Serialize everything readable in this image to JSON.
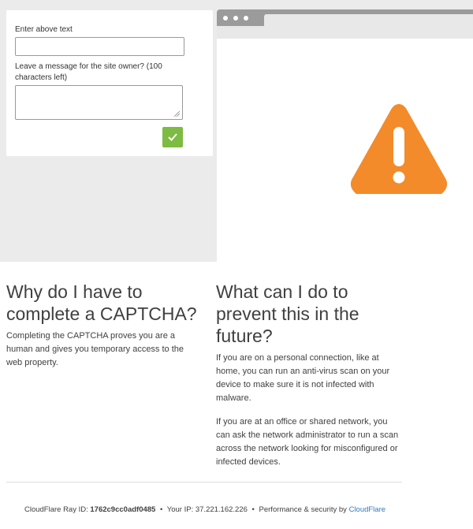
{
  "captcha_form": {
    "input_label": "Enter above text",
    "input_value": "",
    "message_label": "Leave a message for the site owner? (100 characters left)",
    "message_value": ""
  },
  "section_why": {
    "heading": "Why do I have to complete a CAPTCHA?",
    "body": "Completing the CAPTCHA proves you are a human and gives you temporary access to the web property."
  },
  "section_prevent": {
    "heading": "What can I do to prevent this in the future?",
    "paragraph1": "If you are on a personal connection, like at home, you can run an anti-virus scan on your device to make sure it is not infected with malware.",
    "paragraph2": "If you are at an office or shared network, you can ask the network administrator to run a scan across the network looking for misconfigured or infected devices."
  },
  "footer": {
    "ray_label": "CloudFlare Ray ID:",
    "ray_id": "1762c9cc0adf0485",
    "ip_label": "Your IP:",
    "ip": "37.221.162.226",
    "perf_text": "Performance & security by",
    "perf_link": "CloudFlare"
  },
  "colors": {
    "warning": "#f38b2a",
    "submit": "#7dbb42",
    "link": "#2f7bbf"
  },
  "icons": [
    "checkmark-icon",
    "warning-icon",
    "resize-handle-icon"
  ]
}
